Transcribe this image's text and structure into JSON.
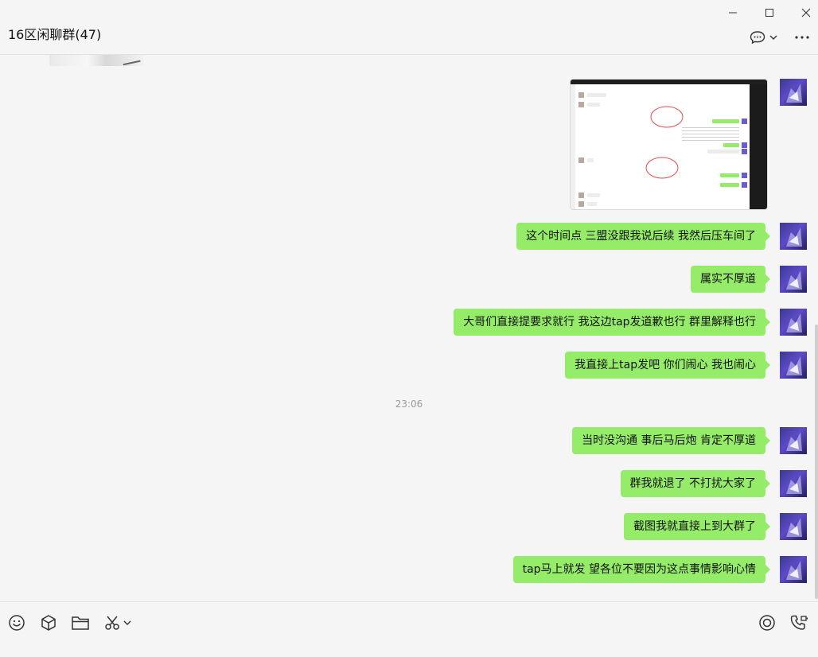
{
  "window": {
    "title": "16区闲聊群(47)",
    "controls": [
      "minimize-icon",
      "maximize-icon",
      "close-icon"
    ]
  },
  "header_actions": [
    "chat-bubble-icon",
    "chevron-down-icon",
    "more-icon"
  ],
  "messages": [
    {
      "type": "image",
      "sender": "self"
    },
    {
      "type": "text",
      "sender": "self",
      "text": "这个时间点  三盟没跟我说后续  我然后压车间了"
    },
    {
      "type": "text",
      "sender": "self",
      "text": "属实不厚道"
    },
    {
      "type": "text",
      "sender": "self",
      "text": "大哥们直接提要求就行  我这边tap发道歉也行  群里解释也行"
    },
    {
      "type": "text",
      "sender": "self",
      "text": "我直接上tap发吧  你们闹心   我也闹心"
    },
    {
      "type": "time",
      "text": "23:06"
    },
    {
      "type": "text",
      "sender": "self",
      "text": "当时没沟通   事后马后炮  肯定不厚道"
    },
    {
      "type": "text",
      "sender": "self",
      "text": "群我就退了  不打扰大家了"
    },
    {
      "type": "text",
      "sender": "self",
      "text": "截图我就直接上到大群了"
    },
    {
      "type": "text",
      "sender": "self",
      "text": "tap马上就发   望各位不要因为这点事情影响心情"
    }
  ],
  "toolbar": {
    "left_icons": [
      "emoji-icon",
      "package-icon",
      "folder-icon",
      "scissors-icon",
      "chevron-down-icon"
    ],
    "right_icons": [
      "record-icon",
      "voice-video-call-icon"
    ]
  },
  "colors": {
    "background": "#f5f5f5",
    "self_bubble": "#95ec69",
    "divider": "#e2e2e2",
    "timestamp": "#9a9a9a"
  }
}
